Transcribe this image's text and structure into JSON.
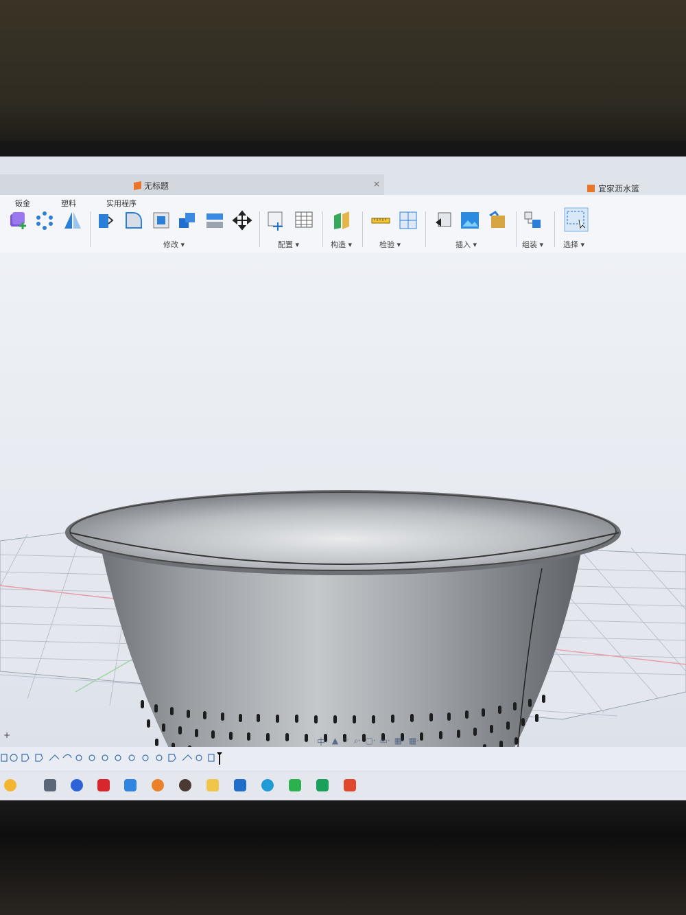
{
  "document": {
    "tab_title": "无标题",
    "tab_close": "×",
    "right_title": "宜家沥水篮"
  },
  "ribbon": {
    "menus": [
      "钣金",
      "塑料",
      "实用程序"
    ],
    "groups": {
      "modify": "修改 ▾",
      "configure": "配置 ▾",
      "construct": "构造 ▾",
      "inspect": "检验 ▾",
      "insert": "插入 ▾",
      "assemble": "组装 ▾",
      "select": "选择 ▾"
    }
  },
  "navbar": {
    "items": [
      "中·",
      "▲",
      "☞",
      "⌕·",
      "▢·",
      "▭·",
      "▦·",
      "▦·"
    ]
  },
  "viewport": {
    "add_symbol": "+"
  },
  "colors": {
    "accent": "#1e7bd6",
    "doc_icon": "#e8762a",
    "viewport_bg": "#e9edf3"
  },
  "icons": {
    "toolbar": [
      "new-component-icon",
      "pattern-icon",
      "mirror-icon",
      "press-pull-icon",
      "fillet-icon",
      "shell-icon",
      "combine-icon",
      "split-icon",
      "move-icon",
      "parameters-icon",
      "table-icon",
      "plane-icon",
      "measure-icon",
      "section-analysis-icon",
      "insert-derive-icon",
      "canvas-icon",
      "decal-icon",
      "joint-icon",
      "select-icon"
    ],
    "taskbar": [
      "start-icon",
      "task-view-icon",
      "browser-icon",
      "wps-icon",
      "cloud-icon",
      "blender-icon",
      "avatar-icon",
      "folder-icon",
      "vscode-icon",
      "edge-icon",
      "wechat-icon",
      "green-app-icon",
      "red-app-icon"
    ]
  }
}
